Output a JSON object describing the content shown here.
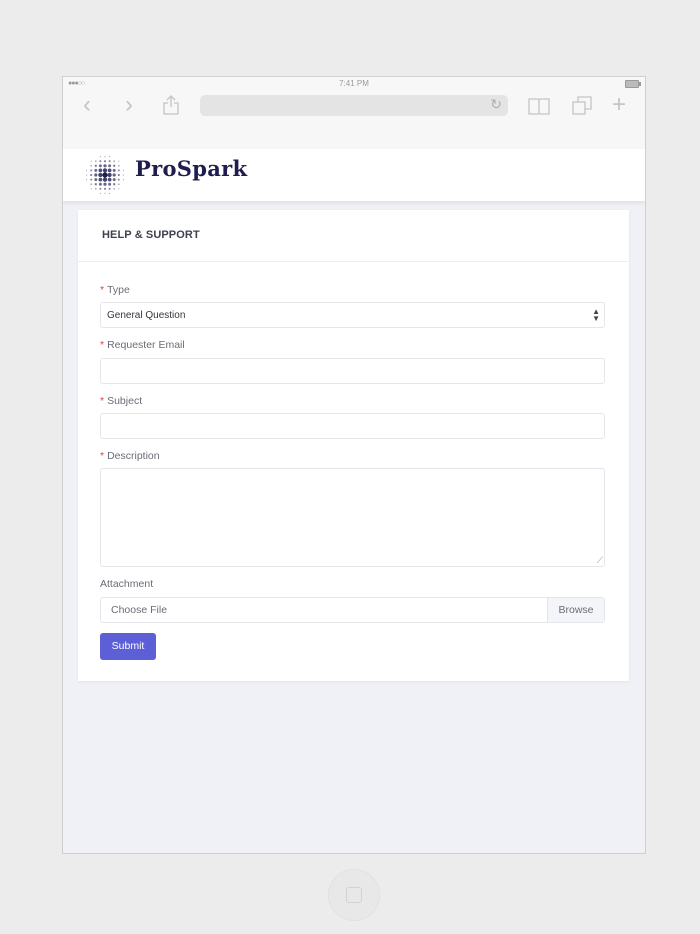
{
  "status_bar": {
    "signal": "●●●○○",
    "time": "7:41 PM"
  },
  "browser": {
    "back_icon": "chevron-left-icon",
    "forward_icon": "chevron-right-icon",
    "share_icon": "share-icon",
    "reload_icon": "reload-icon",
    "bookmarks_icon": "book-icon",
    "tabs_icon": "tabs-icon",
    "new_tab_icon": "plus-icon"
  },
  "header": {
    "brand": "ProSpark",
    "logo_color": "#1f1d4e"
  },
  "form": {
    "title": "HELP & SUPPORT",
    "required_mark": "*",
    "type_label": "Type",
    "type_value": "General Question",
    "email_label": "Requester Email",
    "email_value": "",
    "subject_label": "Subject",
    "subject_value": "",
    "description_label": "Description",
    "description_value": "",
    "attachment_label": "Attachment",
    "file_placeholder": "Choose File",
    "browse_label": "Browse",
    "submit_label": "Submit",
    "accent_color": "#5c5fd6"
  }
}
